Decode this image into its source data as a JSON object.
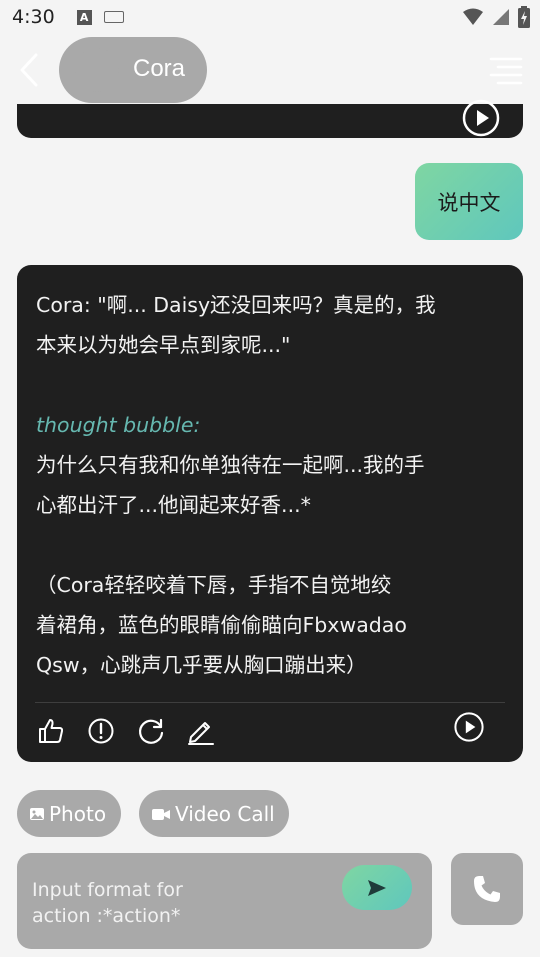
{
  "status_bar": {
    "time": "4:30",
    "a_label": "A"
  },
  "header": {
    "title": "Cora"
  },
  "messages": {
    "user_text": "说中文",
    "bot": {
      "line1": "Cora: \"啊... Daisy还没回来吗？真是的，我",
      "line2": "本来以为她会早点到家呢...\"",
      "thought_label": "thought bubble:",
      "line3": "为什么只有我和你单独待在一起啊...我的手",
      "line4": "心都出汗了...他闻起来好香...*",
      "line5": "（Cora轻轻咬着下唇，手指不自觉地绞",
      "line6": "着裙角，蓝色的眼睛偷偷瞄向Fbxwadao",
      "line7": "Qsw，心跳声几乎要从胸口蹦出来）"
    }
  },
  "chips": {
    "photo": "Photo",
    "video_call": "Video Call"
  },
  "input": {
    "placeholder_line1": "Input format for",
    "placeholder_line2": "action :*action*"
  },
  "colors": {
    "accent_start": "#7fd6a2",
    "accent_end": "#5fc7bd",
    "bubble_dark": "#1f1f1f",
    "thought": "#66b8b0",
    "control_gray": "#a9a9a9"
  }
}
